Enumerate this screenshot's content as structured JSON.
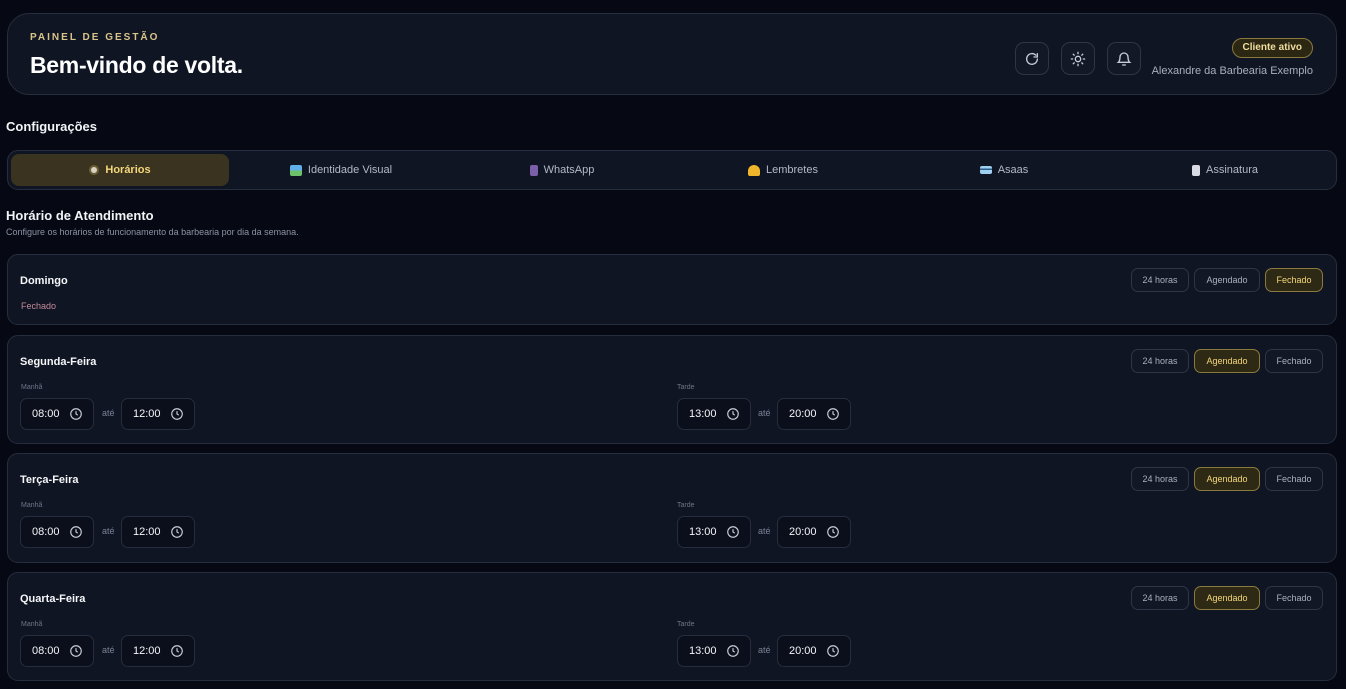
{
  "header": {
    "eyebrow": "PAINEL DE GESTÃO",
    "welcome": "Bem-vindo de volta.",
    "badge": "Cliente ativo",
    "client_name": "Alexandre da Barbearia Exemplo",
    "icons": [
      "refresh-icon",
      "sun-icon",
      "bell-icon"
    ]
  },
  "settings": {
    "title": "Configurações",
    "tabs": [
      {
        "label": "Horários",
        "icon": "clock-icon",
        "active": true
      },
      {
        "label": "Identidade Visual",
        "icon": "image-icon",
        "active": false
      },
      {
        "label": "WhatsApp",
        "icon": "phone-icon",
        "active": false
      },
      {
        "label": "Lembretes",
        "icon": "bell-icon",
        "active": false
      },
      {
        "label": "Asaas",
        "icon": "card-icon",
        "active": false
      },
      {
        "label": "Assinatura",
        "icon": "document-icon",
        "active": false
      }
    ]
  },
  "schedule": {
    "title": "Horário de Atendimento",
    "subtitle": "Configure os horários de funcionamento da barbearia por dia da semana.",
    "mode_labels": {
      "full": "24 horas",
      "scheduled": "Agendado",
      "closed": "Fechado"
    },
    "morning_label": "Manhã",
    "afternoon_label": "Tarde",
    "until_label": "até",
    "closed_text": "Fechado",
    "days": [
      {
        "name": "Domingo",
        "mode": "closed"
      },
      {
        "name": "Segunda-Feira",
        "mode": "scheduled",
        "morning": [
          "08:00",
          "12:00"
        ],
        "afternoon": [
          "13:00",
          "20:00"
        ]
      },
      {
        "name": "Terça-Feira",
        "mode": "scheduled",
        "morning": [
          "08:00",
          "12:00"
        ],
        "afternoon": [
          "13:00",
          "20:00"
        ]
      },
      {
        "name": "Quarta-Feira",
        "mode": "scheduled",
        "morning": [
          "08:00",
          "12:00"
        ],
        "afternoon": [
          "13:00",
          "20:00"
        ]
      }
    ]
  },
  "colors": {
    "accent": "#f3d77a",
    "background": "#060913",
    "card": "#101523",
    "closed": "#c28a99"
  }
}
